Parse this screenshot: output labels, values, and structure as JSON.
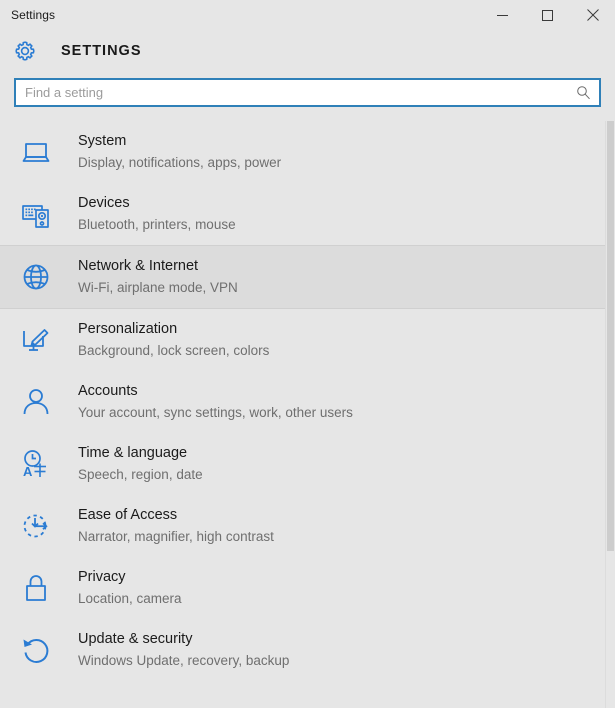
{
  "window": {
    "title": "Settings",
    "controls": [
      {
        "name": "minimize",
        "label": "—"
      },
      {
        "name": "maximize",
        "label": "□"
      },
      {
        "name": "close",
        "label": "✕"
      }
    ]
  },
  "header": {
    "icon": "gear-icon",
    "title": "SETTINGS",
    "accent_color": "#2f80b8"
  },
  "search": {
    "placeholder": "Find a setting",
    "value": "",
    "icon": "search-icon",
    "border_color": "#2f80b8"
  },
  "settings_list": {
    "highlight_color": "#dcdcdc",
    "icon_color": "#2b7cd3",
    "items": [
      {
        "icon": "laptop-icon",
        "title": "System",
        "subtitle": "Display, notifications, apps, power",
        "highlighted": false
      },
      {
        "icon": "devices-icon",
        "title": "Devices",
        "subtitle": "Bluetooth, printers, mouse",
        "highlighted": false
      },
      {
        "icon": "globe-icon",
        "title": "Network & Internet",
        "subtitle": "Wi-Fi, airplane mode, VPN",
        "highlighted": true
      },
      {
        "icon": "paintbrush-monitor-icon",
        "title": "Personalization",
        "subtitle": "Background, lock screen, colors",
        "highlighted": false
      },
      {
        "icon": "person-icon",
        "title": "Accounts",
        "subtitle": "Your account, sync settings, work, other users",
        "highlighted": false
      },
      {
        "icon": "clock-language-icon",
        "title": "Time & language",
        "subtitle": "Speech, region, date",
        "highlighted": false
      },
      {
        "icon": "ease-of-access-icon",
        "title": "Ease of Access",
        "subtitle": "Narrator, magnifier, high contrast",
        "highlighted": false
      },
      {
        "icon": "lock-icon",
        "title": "Privacy",
        "subtitle": "Location, camera",
        "highlighted": false
      },
      {
        "icon": "refresh-icon",
        "title": "Update & security",
        "subtitle": "Windows Update, recovery, backup",
        "highlighted": false
      }
    ]
  },
  "scrollbar": {
    "thumb_color": "#cdcdcd"
  }
}
